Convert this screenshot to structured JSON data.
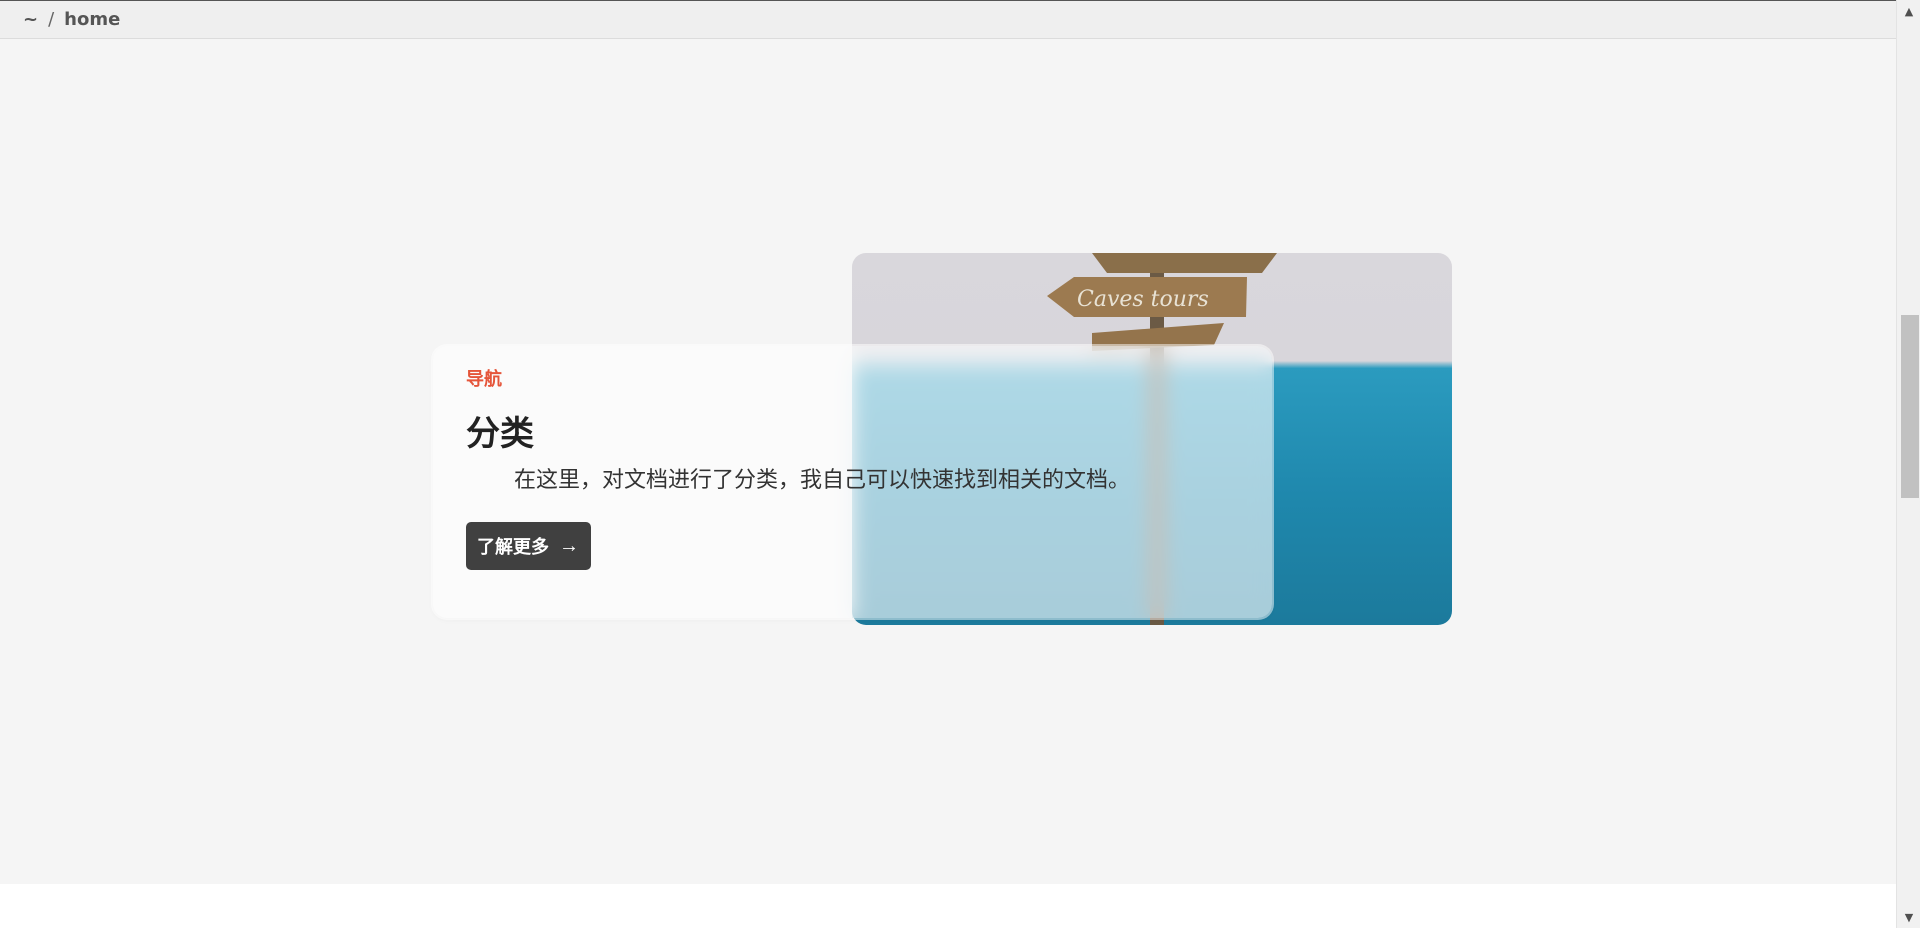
{
  "breadcrumb": {
    "home_symbol": "~",
    "separator": "/",
    "current": "home"
  },
  "card": {
    "eyebrow": "导航",
    "title": "分类",
    "description": "在这里，对文档进行了分类，我自己可以快速找到相关的文档。",
    "button_label": "了解更多",
    "button_arrow": "→",
    "image_sign_text": "Caves tours"
  },
  "scrollbar": {
    "up_icon": "▲",
    "down_icon": "▼"
  },
  "colors": {
    "accent": "#e5553a",
    "button_bg": "#404040",
    "page_bg": "#f5f5f5"
  }
}
